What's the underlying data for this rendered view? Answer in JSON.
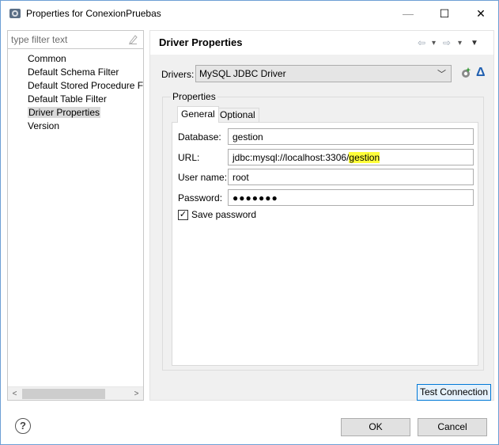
{
  "window": {
    "title": "Properties for ConexionPruebas",
    "minimize_label": "—",
    "maximize_label": "☐",
    "close_label": "✕"
  },
  "filter": {
    "placeholder": "type filter text"
  },
  "tree": {
    "items": [
      {
        "label": "Common"
      },
      {
        "label": "Default Schema Filter"
      },
      {
        "label": "Default Stored Procedure F"
      },
      {
        "label": "Default Table Filter"
      },
      {
        "label": "Driver Properties",
        "selected": true
      },
      {
        "label": "Version"
      }
    ]
  },
  "scroll": {
    "left": "<",
    "right": ">"
  },
  "header": {
    "title": "Driver Properties",
    "back_icon": "⇦",
    "back_menu": "▾",
    "forward_icon": "⇨",
    "forward_menu": "▾",
    "view_menu": "▼"
  },
  "drivers": {
    "label": "Drivers:",
    "value": "MySQL JDBC Driver",
    "arrow": "﹀",
    "delta": "Δ"
  },
  "properties": {
    "group_label": "Properties",
    "tabs": [
      {
        "label": "General"
      },
      {
        "label": "Optional"
      }
    ],
    "database_label": "Database:",
    "database_value": "gestion",
    "url_label": "URL:",
    "url_prefix": "jdbc:mysql://localhost:3306/",
    "url_highlight": "gestion",
    "username_label": "User name:",
    "username_value": "root",
    "password_label": "Password:",
    "password_value": "●●●●●●●",
    "save_password_label": "Save password",
    "save_password_checked": true,
    "check_mark": "✓"
  },
  "buttons": {
    "test_connection": "Test Connection",
    "ok": "OK",
    "cancel": "Cancel",
    "help": "?"
  },
  "colors": {
    "highlight": "#ffff3a",
    "accent": "#0078d7"
  }
}
